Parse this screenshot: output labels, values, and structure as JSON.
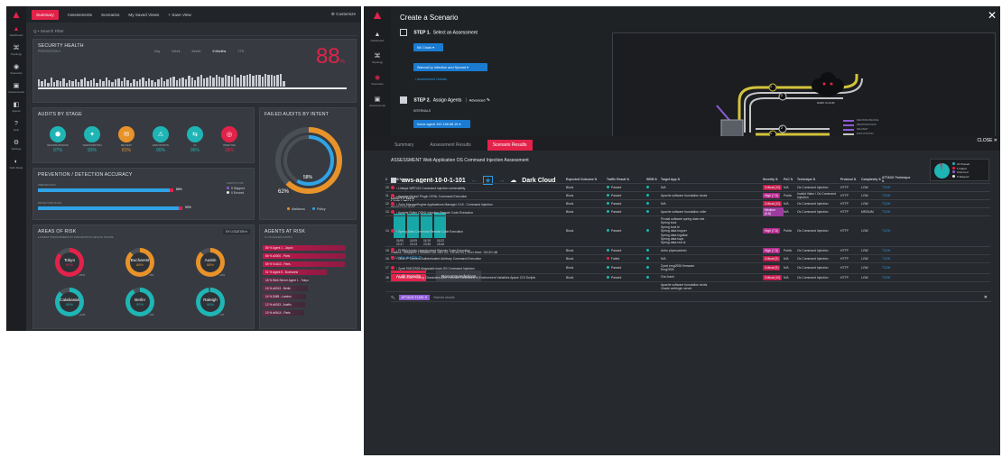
{
  "dashboard": {
    "sidebar": [
      {
        "label": "Dashboard",
        "icon": "dashboard-icon",
        "glyph": "▲"
      },
      {
        "label": "Topology",
        "icon": "topology-icon",
        "glyph": "⌘"
      },
      {
        "label": "Scenarios",
        "icon": "scenarios-icon",
        "glyph": "◉"
      },
      {
        "label": "Assessments",
        "icon": "assessments-icon",
        "glyph": "▣"
      },
      {
        "label": "Agents",
        "icon": "agents-icon",
        "glyph": "◧"
      },
      {
        "label": "Help",
        "icon": "help-icon",
        "glyph": "?"
      },
      {
        "label": "Settings",
        "icon": "settings-icon",
        "glyph": "⚙"
      },
      {
        "label": "Dark Mode",
        "icon": "dark-mode-icon",
        "glyph": "◐"
      }
    ],
    "nav": {
      "summary": "Summary",
      "assessments": "Assessments",
      "scenarios": "Scenarios",
      "saved_views": "My Saved Views",
      "save_view": "+ Save View",
      "customize": "⚙ Customize"
    },
    "search_placeholder": "Q  •  Search Filter",
    "security_health": {
      "title": "SECURITY HEALTH",
      "select": "PREVENTION",
      "ranges": [
        "Day",
        "Week",
        "Month",
        "6 Months",
        "YTD"
      ],
      "active_range": "6 Months",
      "score": "88",
      "score_unit": "%",
      "bar_levels": [
        0.55,
        0.45,
        0.6,
        0.3,
        0.7,
        0.35,
        0.5,
        0.4,
        0.65,
        0.3,
        0.5,
        0.45,
        0.6,
        0.35,
        0.55,
        0.75,
        0.4,
        0.5,
        0.65,
        0.3,
        0.6,
        0.45,
        0.7,
        0.5,
        0.35,
        0.55,
        0.65,
        0.4,
        0.75,
        0.5,
        0.3,
        0.6,
        0.45,
        0.55,
        0.7,
        0.4,
        0.65,
        0.5,
        0.35,
        0.6,
        0.75,
        0.45,
        0.55,
        0.7,
        0.8,
        0.5,
        0.65,
        0.75,
        0.6,
        0.85,
        0.7,
        0.5,
        0.8,
        0.9,
        0.65,
        0.75,
        0.85,
        0.7,
        0.9,
        0.8,
        0.75,
        0.95,
        0.85,
        0.8,
        0.9,
        0.7,
        0.95,
        0.85,
        0.9,
        1.0,
        0.85,
        0.95,
        0.9,
        0.8,
        1.0,
        0.9,
        0.95,
        0.85,
        0.9,
        1.0,
        0.4
      ]
    },
    "audits_by_stage": {
      "title": "AUDITS BY STAGE",
      "stages": [
        {
          "label": "RECONNAISSANCE",
          "value": "97%",
          "color": "#1fb5b5",
          "icon": "recon-icon",
          "glyph": "⬢"
        },
        {
          "label": "WEAPONIZATION",
          "value": "93%",
          "color": "#1fb5b5",
          "icon": "weaponization-icon",
          "glyph": "✦"
        },
        {
          "label": "DELIVERY",
          "value": "81%",
          "color": "#e8922a",
          "icon": "delivery-icon",
          "glyph": "✉"
        },
        {
          "label": "EXPLOITATION",
          "value": "90%",
          "color": "#1fb5b5",
          "icon": "exploitation-icon",
          "glyph": "⚠"
        },
        {
          "label": "C2",
          "value": "96%",
          "color": "#1fb5b5",
          "icon": "c2-icon",
          "glyph": "⇆"
        },
        {
          "label": "OBJECTIVE",
          "value": "38%",
          "color": "#e3224a",
          "icon": "objective-icon",
          "glyph": "◎"
        }
      ]
    },
    "failed_by_intent": {
      "title": "FAILED AUDITS BY INTENT",
      "inner": "58%",
      "outer": "62%",
      "legend": [
        "Malicious",
        "Policy"
      ],
      "malicious_frac": 0.62,
      "policy_frac": 0.38
    },
    "accuracy": {
      "title": "PREVENTION / DETECTION  ACCURACY",
      "rows": [
        {
          "label": "PREVENTION",
          "value": "86%",
          "fraction": 0.86,
          "color": "#2fa3e6",
          "marker": "#e3224a"
        },
        {
          "label": "DETECTION RATE",
          "value": "92%",
          "fraction": 0.92,
          "color": "#2fa3e6",
          "marker": "#e3224a"
        }
      ],
      "legend_head": "AUDITS THIS",
      "legend": [
        "5 Skipped",
        "0 Errored"
      ]
    },
    "areas_of_risk": {
      "title": "AREAS OF RISK",
      "subtitle": "LOWEST PERFORMERS BY PREVENTION HEALTH SCORE",
      "select": "BY LOCATION",
      "locations": [
        {
          "name": "Tokyo",
          "score": "86%",
          "change": "-21%",
          "color": "#e3224a",
          "frac": 0.86
        },
        {
          "name": "Bucharest",
          "score": "88%",
          "change": "-5%",
          "color": "#e8922a",
          "frac": 0.88
        },
        {
          "name": "Austin",
          "score": "88%",
          "change": "+4%",
          "color": "#e8922a",
          "frac": 0.88
        },
        {
          "name": "Calabasas",
          "score": "88%",
          "change": "+11%",
          "color": "#1fb5b5",
          "frac": 0.88
        },
        {
          "name": "Berlin",
          "score": "92%",
          "change": "-2%",
          "color": "#1fb5b5",
          "frac": 0.92
        },
        {
          "name": "Raleigh",
          "score": "98%",
          "change": "-1%",
          "color": "#1fb5b5",
          "frac": 0.98
        }
      ]
    },
    "agents_at_risk": {
      "title": "AGENTS AT RISK",
      "subtitle": "% OF FAILED AUDITS",
      "agents": [
        {
          "label": "86 %   Agent 1 - Japan",
          "frac": 0.86
        },
        {
          "label": "86 %   a0000 - Paris",
          "frac": 0.86
        },
        {
          "label": "85 %   VxA10 - Paris",
          "frac": 0.85
        },
        {
          "label": "51 %   Agent 8 - Bucharest",
          "frac": 0.51
        },
        {
          "label": "18 %   Web Server Agent 1 - Tokyo",
          "frac": 0.18
        },
        {
          "label": "16 %   a0013 - Berlin",
          "frac": 0.16
        },
        {
          "label": "14 %   DMB - London",
          "frac": 0.14
        },
        {
          "label": "12 %   a0013 - Austin",
          "frac": 0.12
        },
        {
          "label": "10 %   aVA14 - Paris",
          "frac": 0.1
        }
      ]
    }
  },
  "scenario": {
    "title": "Create a Scenario",
    "close": "✕",
    "sidebar": [
      {
        "label": "Dashboard",
        "icon": "dashboard-icon",
        "glyph": "▲"
      },
      {
        "label": "Topology",
        "icon": "topology-icon",
        "glyph": "⌘"
      },
      {
        "label": "Scenarios",
        "icon": "scenarios-icon",
        "glyph": "◉"
      },
      {
        "label": "Assessments",
        "icon": "assessments-icon",
        "glyph": "▣"
      }
    ],
    "step1": "STEP 1.",
    "step1_label": "Select an Assessment",
    "kill_chain": "Kill Chain",
    "assessment": "WannaCry Infection and Spread",
    "details": "i  Assessment Details",
    "step2": "STEP 2.",
    "step2_label": "Assign Agents",
    "advanced": "Advanced",
    "internals": "INTERNALS",
    "agent": "home agent 192.168.68.15",
    "cloud_label": "DARK CLOUD",
    "badges": [
      "1",
      "2",
      "1",
      "2"
    ],
    "map_legend": [
      "RECONNAISSANCE",
      "WEAPONIZATION",
      "DELIVERY",
      "EXPLOITATION",
      "INSTALLATION"
    ]
  },
  "results": {
    "tabs": [
      "Summary",
      "Assessment Results",
      "Scenario Results"
    ],
    "active_tab": "Scenario Results",
    "close": "CLOSE ✕",
    "assessment_title": "ASSESSMENT  Web Application OS Command Injection Assessment",
    "agent": "aws-agent-10-0-1-101",
    "cloud": "Dark Cloud",
    "summary_legend": [
      "23 Passed",
      "1 Failed",
      "0 Errored",
      "0 Skipped"
    ],
    "history_title": "HISTORY",
    "history_sub": "RESULTS BY RUN",
    "history_runs": [
      {
        "date": "01/09",
        "time": "22:47",
        "level": 0.9
      },
      {
        "date": "01/09",
        "time": "23:13",
        "level": 0.9
      },
      {
        "date": "01/19",
        "time": "23:35",
        "level": 0.9
      },
      {
        "date": "01/22",
        "time": "15:46",
        "level": 0.95
      }
    ],
    "status": "Status: Stopped   |   Started on Jan 22, 15:46:31   |   Run time: 00:20:48",
    "new_audits": "No new audits",
    "buttons": [
      "Audit Results",
      "Recommendations"
    ],
    "filter_chip": "ATT&CK:T1190",
    "filter_count": "Narrow results",
    "columns": [
      "#",
      "Audit Name",
      "Expected Outcome",
      "Traffic Result",
      "SIEM",
      "Target App",
      "Severity",
      "PoC",
      "Technique",
      "Protocol",
      "Complexity",
      "ATT&CK Technique"
    ],
    "rows": [
      {
        "n": "10",
        "name": "Linksys WRT110 Command Injection vulnerability",
        "exp": "Block",
        "res": "Passed",
        "siem": "",
        "app": "N/A",
        "sev": "Critical (10)",
        "sevc": "#c2184b",
        "poc": "N/A",
        "tech": "Os Command Injection",
        "proto": "HTTP",
        "cx": "LOW",
        "att": "T1190"
      },
      {
        "n": "11",
        "name": "Apache Struts2 Plugin OGNL Command Execution",
        "exp": "Block",
        "res": "Passed",
        "siem": "",
        "app": "Apache software foundation struts",
        "sev": "High (7.5)",
        "sevc": "#b5298f",
        "poc": "Public",
        "tech": "Invalid Value / Os Command Injection",
        "proto": "HTTP",
        "cx": "LOW",
        "att": "T1190"
      },
      {
        "n": "12",
        "name": "Zoho ManageEngine Applications Manager 13.8 - Command Injection",
        "exp": "Block",
        "res": "Passed",
        "siem": "",
        "app": "N/A",
        "sev": "Critical (10)",
        "sevc": "#c2184b",
        "poc": "N/A",
        "tech": "Os Command Injection",
        "proto": "HTTP",
        "cx": "LOW",
        "att": "T1190"
      },
      {
        "n": "13",
        "name": "Apache Roller OGNL Injection Remote Code Execution",
        "exp": "Block",
        "res": "Passed",
        "siem": "",
        "app": "Apache software foundation roller",
        "sev": "Medium (6.8)",
        "sevc": "#9c3c9e",
        "poc": "N/A",
        "tech": "Os Command Injection",
        "proto": "HTTP",
        "cx": "MEDIUM",
        "att": "T1190"
      },
      {
        "n": "14",
        "name": "Spring Data Commons Remote Code Execution",
        "exp": "Block",
        "res": "Passed",
        "siem": "",
        "app": "Pivotal software spring data rest / Spring boot / Spring boot ie / Spring data hopper / Spring data ingalise / Spring data kays / Spring data rest ie",
        "sev": "High (7.5)",
        "sevc": "#b5298f",
        "poc": "Public",
        "tech": "Os Command Injection",
        "proto": "HTTP",
        "cx": "LOW",
        "att": "T1190"
      },
      {
        "n": "15",
        "name": "PHPMyAdmin Unauthorized Remote Code Execution",
        "exp": "Block",
        "res": "Passed",
        "siem": "",
        "app": "Anbu phpmoadmin",
        "sev": "High (7.5)",
        "sevc": "#b5298f",
        "poc": "Public",
        "tech": "Os Command Injection",
        "proto": "HTTP",
        "cx": "LOW",
        "att": "T1190"
      },
      {
        "n": "16",
        "name": "Dlink IP Camera Authenticated Arbitrary Command Execution",
        "exp": "Block",
        "res": "Failed",
        "siem": "",
        "app": "N/A",
        "sev": "Critical (9)",
        "sevc": "#c2184b",
        "poc": "N/A",
        "tech": "Os Command Injection",
        "proto": "HTTP",
        "cx": "LOW",
        "att": "T1190"
      },
      {
        "n": "17",
        "name": "Zyxel EMG2926 diagnostic tools OS Command Injection",
        "exp": "Block",
        "res": "Passed",
        "siem": "",
        "app": "Zyxel emg2926 firmware / Emg2926",
        "sev": "Critical (9)",
        "sevc": "#c2184b",
        "poc": "N/A",
        "tech": "Os Command Injection",
        "proto": "HTTP",
        "cx": "LOW",
        "att": "T1190"
      },
      {
        "n": "18",
        "name": "DNIU Bash Trailing Characters After Function Definitions in Environment Variables Apace CGI Scripts",
        "exp": "Block",
        "res": "Passed",
        "siem": "",
        "app": "Gnu bash",
        "sev": "Critical (10)",
        "sevc": "#c2184b",
        "poc": "N/A",
        "tech": "Os Command Injection",
        "proto": "HTTP",
        "cx": "LOW",
        "att": "T1190"
      },
      {
        "n": "",
        "name": "",
        "exp": "",
        "res": "",
        "siem": "",
        "app": "Apache software foundation struts / Oracle weblogic server",
        "sev": "",
        "sevc": "",
        "poc": "",
        "tech": "",
        "proto": "",
        "cx": "",
        "att": ""
      }
    ]
  }
}
